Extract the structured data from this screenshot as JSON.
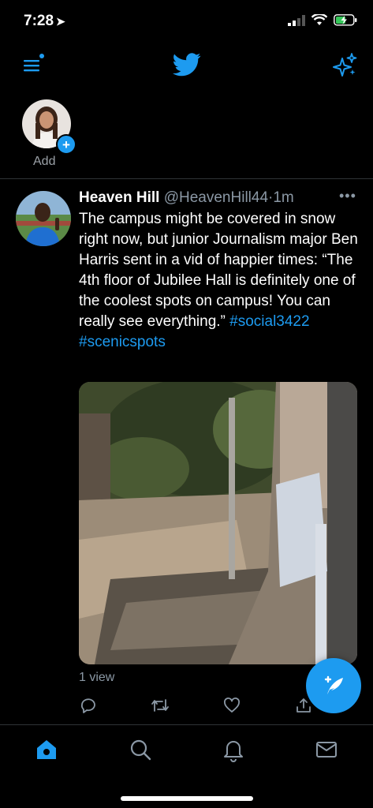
{
  "status_bar": {
    "time": "7:28"
  },
  "fleets": {
    "add_label": "Add"
  },
  "tweet": {
    "name": "Heaven Hill",
    "handle": "@HeavenHill44",
    "separator": "·",
    "time": "1m",
    "more": "•••",
    "text": "The campus might be covered in snow right now, but junior Journalism major Ben Harris sent in a vid of happier times: “The 4th floor of Jubilee Hall is definitely one of the coolest spots on campus! You can really see everything.”",
    "hashtags": [
      "#social3422",
      "#scenicspots"
    ],
    "views": "1 view"
  },
  "colors": {
    "accent": "#1d9bf0",
    "background": "#000000",
    "secondary_text": "#8b98a5"
  },
  "icons": {
    "topbar": [
      "menu-icon",
      "twitter-bird-icon",
      "sparkle-icon"
    ],
    "actions": [
      "reply-icon",
      "retweet-icon",
      "like-icon",
      "share-icon"
    ],
    "tabs": [
      "home-icon",
      "search-icon",
      "notifications-icon",
      "messages-icon"
    ],
    "fab": "compose-tweet-icon"
  }
}
